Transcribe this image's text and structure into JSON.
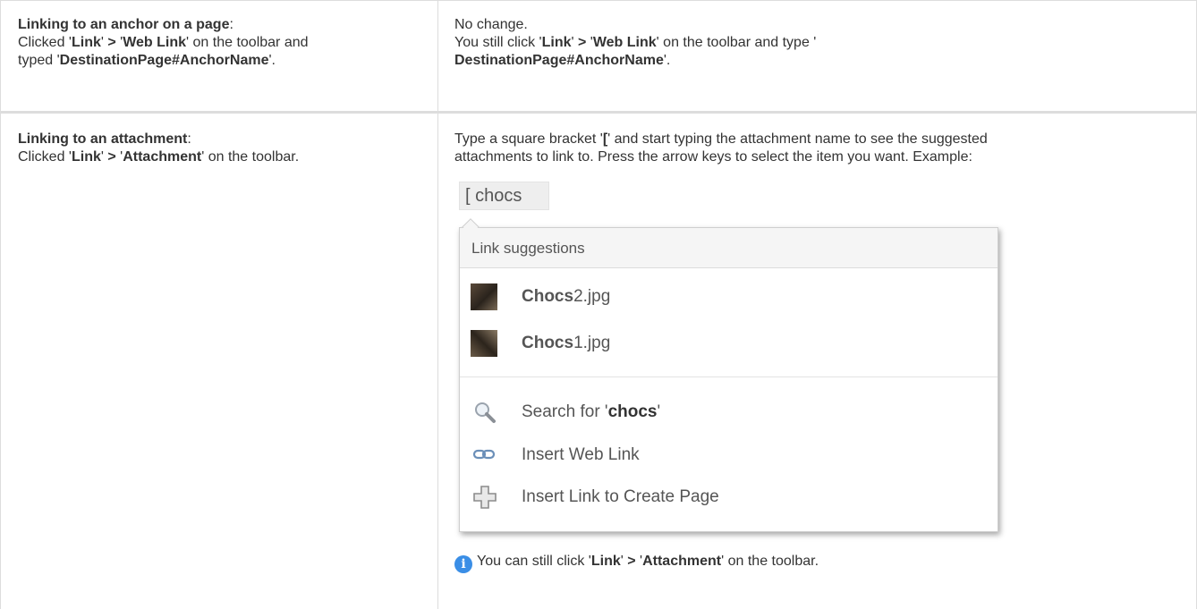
{
  "rows": [
    {
      "left": {
        "heading": "Linking to an anchor on a page",
        "heading_suffix": ":",
        "line2": [
          "Clicked '",
          "Link",
          "' ",
          ">",
          " '",
          "Web Link",
          "' on the toolbar and"
        ],
        "line3": [
          "typed '",
          "DestinationPage#AnchorName",
          "'."
        ]
      },
      "right": {
        "line1": "No change.",
        "line2": [
          "You still click '",
          "Link",
          "' ",
          ">",
          " '",
          "Web Link",
          "' on the toolbar and type '"
        ],
        "line3": [
          "DestinationPage#AnchorName",
          "'."
        ]
      }
    },
    {
      "left": {
        "heading": "Linking to an attachment",
        "heading_suffix": ":",
        "line2": [
          "Clicked '",
          "Link",
          "' ",
          ">",
          " '",
          "Attachment",
          "' on the toolbar."
        ]
      },
      "right": {
        "line1": [
          "Type a square bracket '",
          "[",
          "' and start typing the attachment name to see the suggested"
        ],
        "line2": "attachments to link to. Press the arrow keys to select the item you want. Example:",
        "example": {
          "typed_token": "[ chocs",
          "popup_title": "Link suggestions",
          "suggestions": [
            {
              "match": "Chocs",
              "rest": "2.jpg",
              "icon": "image-thumbnail-icon"
            },
            {
              "match": "Chocs",
              "rest": "1.jpg",
              "icon": "image-thumbnail-icon"
            }
          ],
          "actions": [
            {
              "prefix": "Search for '",
              "bold": "chocs",
              "suffix": "'",
              "icon": "magnifier-icon"
            },
            {
              "prefix": "Insert Web Link",
              "bold": "",
              "suffix": "",
              "icon": "chain-link-icon"
            },
            {
              "prefix": "Insert Link to Create Page",
              "bold": "",
              "suffix": "",
              "icon": "plus-icon"
            }
          ]
        },
        "info": [
          "You can still click '",
          "Link",
          "' ",
          ">",
          " '",
          "Attachment",
          "' on the toolbar."
        ],
        "info_icon": "i"
      }
    }
  ],
  "colors": {
    "border": "#dddddd",
    "text": "#333333",
    "info_icon": "#3a8ee6"
  }
}
